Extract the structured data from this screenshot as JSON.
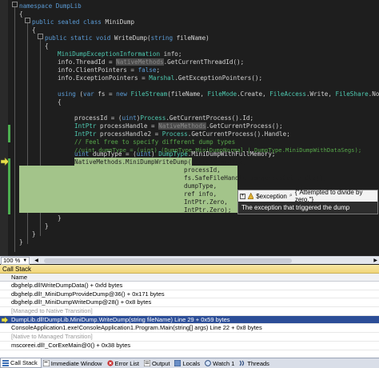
{
  "editor": {
    "code": {
      "l01": "namespace DumpLib",
      "l02": "{",
      "l03a": "public sealed class ",
      "l03b": "MiniDump",
      "l04": "{",
      "l05a": "public static void ",
      "l05b": "WriteDump(",
      "l05c": "string",
      "l05d": " fileName)",
      "l06": "{",
      "l07a": "MiniDumpExceptionInformation",
      "l07b": " info;",
      "l08a": "info.ThreadId = ",
      "l08b": "NativeMethods",
      "l08c": ".GetCurrentThreadId();",
      "l09a": "info.ClientPointers = ",
      "l09b": "false",
      "l09c": ";",
      "l10a": "info.ExceptionPointers = ",
      "l10b": "Marshal",
      "l10c": ".GetExceptionPointers();",
      "l11a": "using",
      "l11b": " (",
      "l11c": "var",
      "l11d": " fs = ",
      "l11e": "new",
      "l11f": " ",
      "l11g": "FileStream",
      "l11h": "(fileName, ",
      "l11i": "FileMode",
      "l11j": ".Create, ",
      "l11k": "FileAccess",
      "l11l": ".Write, ",
      "l11m": "FileShare",
      "l11n": ".None))",
      "l12": "{",
      "l13a": "processId = (",
      "l13b": "uint",
      "l13c": ")",
      "l13d": "Process",
      "l13e": ".GetCurrentProcess().Id;",
      "l14a": "IntPtr",
      "l14b": " processHandle = ",
      "l14c": "NativeMethods",
      "l14d": ".GetCurrentProcess();",
      "l15a": "IntPtr",
      "l15b": " processHandle2 = ",
      "l15c": "Process",
      "l15d": ".GetCurrentProcess().Handle;",
      "l16": "// Feel free to specify different dump types",
      "l17": "//uint dumpType = (uint) (DumpType.MiniDumpNormal | DumpType.MiniDumpWithDataSegs);",
      "l18a": "uint",
      "l18b": " dumpType = (",
      "l18c": "uint",
      "l18d": ") ",
      "l18e": "DumpType",
      "l18f": ".MiniDumpWithFullMemory;",
      "l19a": "NativeMethods",
      "l19b": ".MiniDumpWriteDump(processHandle2,",
      "l20": "processId,",
      "l21": "fs.SafeFileHandle.DangerousGetHandle(),",
      "l22": "dumpType,",
      "l23": "ref info,",
      "l24": "IntPtr.Zero,",
      "l25": "IntPtr.Zero);",
      "l26": "}",
      "l27": "}",
      "l28": "}",
      "l29": "}"
    },
    "datatip": {
      "expand": "+",
      "name": "$exception",
      "value": "{\"Attempted to divide by zero.\"}",
      "description": "The exception that triggered the dump"
    }
  },
  "zoom": {
    "value": "100 %"
  },
  "call_stack": {
    "title": "Call Stack",
    "column_header": "Name",
    "rows": [
      {
        "text": "dbghelp.dll!WriteDumpData() + 0xfd bytes"
      },
      {
        "text": "dbghelp.dll!_MiniDumpProvideDump@36() + 0x171 bytes"
      },
      {
        "text": "dbghelp.dll!_MiniDumpWriteDump@28() + 0x8 bytes"
      },
      {
        "text": "[Managed to Native Transition]"
      },
      {
        "text": "DumpLib.dll!DumpLib.MiniDump.WriteDump(string fileName) Line 29 + 0x59 bytes"
      },
      {
        "text": "ConsoleApplication1.exe!ConsoleApplication1.Program.Main(string[] args) Line 22 + 0x8 bytes"
      },
      {
        "text": "[Native to Managed Transition]"
      },
      {
        "text": "mscoreei.dll!_CorExeMain@0() + 0x38 bytes"
      }
    ]
  },
  "tabs": [
    {
      "label": "Call Stack"
    },
    {
      "label": "Immediate Window"
    },
    {
      "label": "Error List"
    },
    {
      "label": "Output"
    },
    {
      "label": "Locals"
    },
    {
      "label": "Watch 1"
    },
    {
      "label": "Threads"
    }
  ],
  "colors": {
    "editor_background": "#1e1e1e",
    "keyword": "#5b9bd5",
    "type": "#4ec9b0",
    "comment": "#57a64a",
    "current_statement_highlight": "#a3c48a",
    "selected_row": "#2c4e98",
    "panel_title": "#f0d679"
  }
}
